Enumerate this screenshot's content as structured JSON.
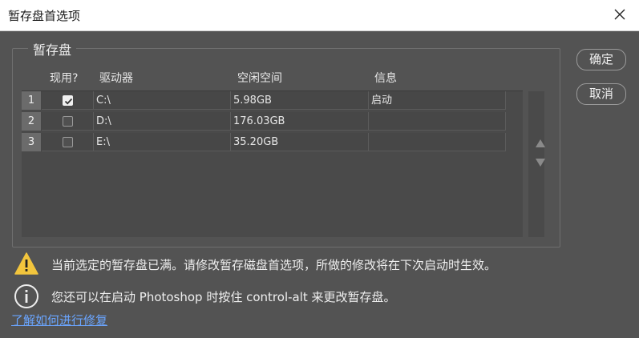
{
  "window": {
    "title": "暂存盘首选项"
  },
  "group": {
    "legend": "暂存盘"
  },
  "table": {
    "headers": {
      "active": "现用?",
      "drive": "驱动器",
      "free_space": "空闲空间",
      "info": "信息"
    },
    "rows": [
      {
        "num": "1",
        "checked": true,
        "drive": "C:\\",
        "free": "5.98GB",
        "info": "启动"
      },
      {
        "num": "2",
        "checked": false,
        "drive": "D:\\",
        "free": "176.03GB",
        "info": ""
      },
      {
        "num": "3",
        "checked": false,
        "drive": "E:\\",
        "free": "35.20GB",
        "info": ""
      }
    ]
  },
  "buttons": {
    "ok": "确定",
    "cancel": "取消"
  },
  "messages": {
    "warning": "当前选定的暂存盘已满。请修改暂存磁盘首选项，所做的修改将在下次启动时生效。",
    "info": "您还可以在启动 Photoshop 时按住 control-alt 来更改暂存盘。"
  },
  "link": {
    "label": "了解如何进行修复"
  },
  "icons": {
    "close": "close-icon",
    "move_up": "triangle-up-icon",
    "move_down": "triangle-down-icon",
    "warning": "warning-triangle-icon",
    "info": "info-circle-icon",
    "check": "checkmark-icon"
  },
  "colors": {
    "dialog_bg": "#535353",
    "title_bg": "#ffffff",
    "link": "#6aa5ff",
    "warning": "#f2c53d"
  }
}
